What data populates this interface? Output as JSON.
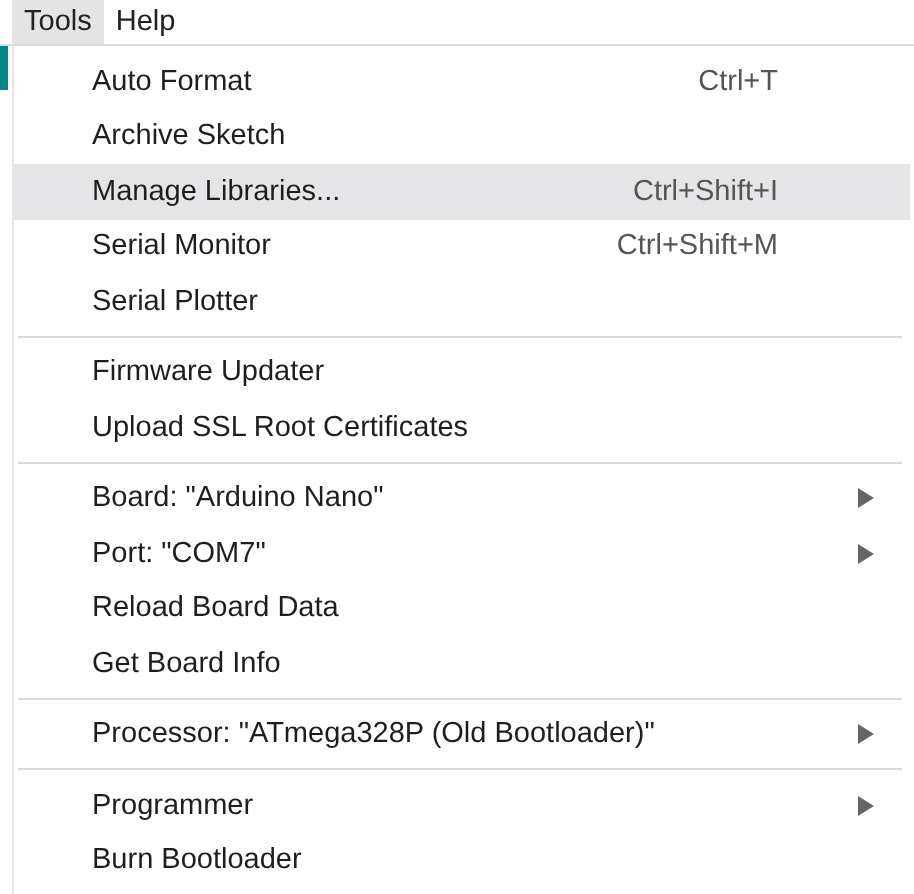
{
  "menubar": [
    {
      "label": "Tools",
      "selected": true
    },
    {
      "label": "Help",
      "selected": false
    }
  ],
  "menu": {
    "groups": [
      {
        "items": [
          {
            "label": "Auto Format",
            "shortcut": "Ctrl+T",
            "submenu": false,
            "selected": false
          },
          {
            "label": "Archive Sketch",
            "submenu": false,
            "selected": false
          },
          {
            "label": "Manage Libraries...",
            "shortcut": "Ctrl+Shift+I",
            "submenu": false,
            "selected": true
          },
          {
            "label": "Serial Monitor",
            "shortcut": "Ctrl+Shift+M",
            "submenu": false,
            "selected": false
          },
          {
            "label": "Serial Plotter",
            "submenu": false,
            "selected": false
          }
        ]
      },
      {
        "items": [
          {
            "label": "Firmware Updater",
            "submenu": false,
            "selected": false
          },
          {
            "label": "Upload SSL Root Certificates",
            "submenu": false,
            "selected": false
          }
        ]
      },
      {
        "items": [
          {
            "label": "Board: \"Arduino Nano\"",
            "submenu": true,
            "selected": false
          },
          {
            "label": "Port: \"COM7\"",
            "submenu": true,
            "selected": false
          },
          {
            "label": "Reload Board Data",
            "submenu": false,
            "selected": false
          },
          {
            "label": "Get Board Info",
            "submenu": false,
            "selected": false
          }
        ]
      },
      {
        "items": [
          {
            "label": "Processor: \"ATmega328P (Old Bootloader)\"",
            "submenu": true,
            "selected": false
          }
        ]
      },
      {
        "items": [
          {
            "label": "Programmer",
            "submenu": true,
            "selected": false
          },
          {
            "label": "Burn Bootloader",
            "submenu": false,
            "selected": false
          }
        ]
      }
    ]
  }
}
